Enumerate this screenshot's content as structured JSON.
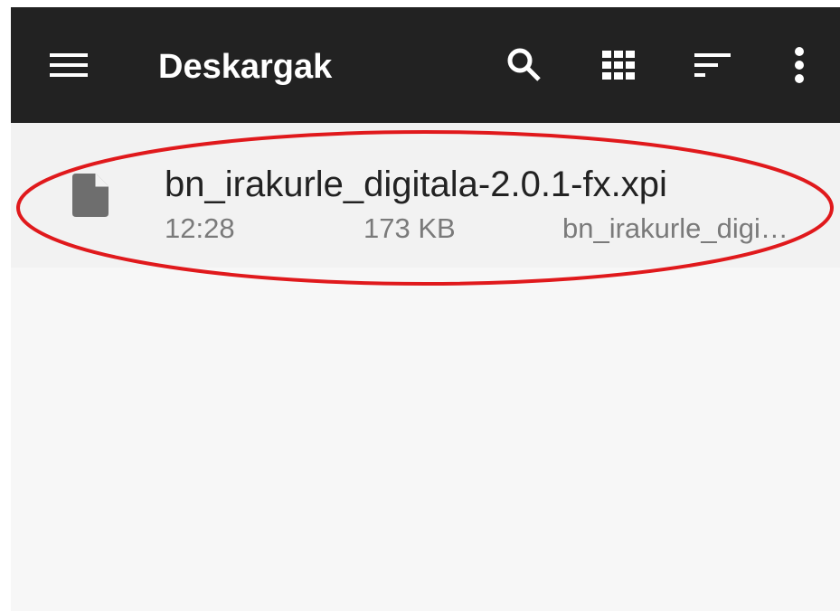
{
  "toolbar": {
    "title": "Deskargak",
    "icons": {
      "menu": "menu-icon",
      "search": "search-icon",
      "grid": "grid-view-icon",
      "sort": "sort-icon",
      "more": "more-vert-icon"
    }
  },
  "files": [
    {
      "name": "bn_irakurle_digitala-2.0.1-fx.xpi",
      "time": "12:28",
      "size": "173 KB",
      "summary": "bn_irakurle_digi…",
      "icon": "file-icon"
    }
  ],
  "colors": {
    "toolbar": "#222222",
    "background": "#f7f7f7",
    "item": "#f2f2f2",
    "highlight": "#e0191c",
    "icon": "#6e6e6e"
  }
}
